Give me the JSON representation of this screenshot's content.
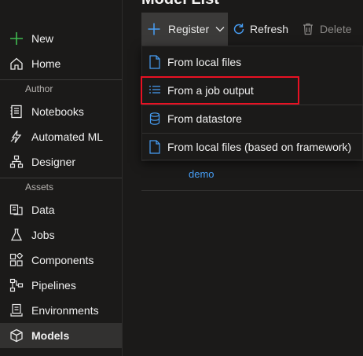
{
  "sidebar": {
    "new_label": "New",
    "home_label": "Home",
    "author_section": "Author",
    "notebooks_label": "Notebooks",
    "automated_ml_label": "Automated ML",
    "designer_label": "Designer",
    "assets_section": "Assets",
    "data_label": "Data",
    "jobs_label": "Jobs",
    "components_label": "Components",
    "pipelines_label": "Pipelines",
    "environments_label": "Environments",
    "models_label": "Models"
  },
  "main": {
    "title": "Model List",
    "demo_link": "demo"
  },
  "toolbar": {
    "register_label": "Register",
    "refresh_label": "Refresh",
    "delete_label": "Delete"
  },
  "register_menu": {
    "items": [
      {
        "label": "From local files",
        "icon": "file-icon"
      },
      {
        "label": "From a job output",
        "icon": "list-icon"
      },
      {
        "label": "From datastore",
        "icon": "database-icon"
      },
      {
        "label": "From local files (based on framework)",
        "icon": "file-icon"
      }
    ]
  },
  "colors": {
    "accent": "#479ef5",
    "highlight_border": "#e81123",
    "new_plus": "#3fb950"
  }
}
